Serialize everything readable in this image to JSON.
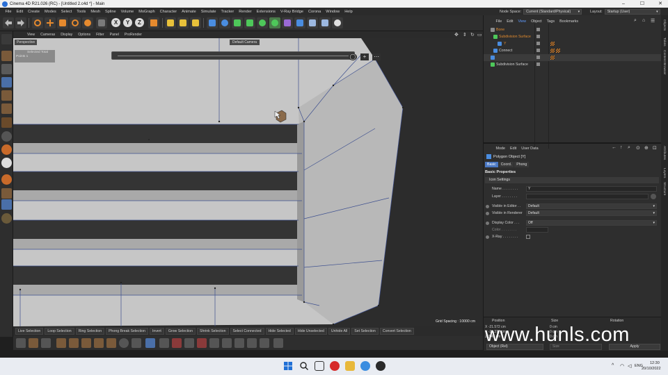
{
  "window": {
    "title": "Cinema 4D R21.026 (RC) - [Untitled 2.c4d *] - Main",
    "controls": [
      "–",
      "☐",
      "✕"
    ]
  },
  "menubar": {
    "items": [
      "File",
      "Edit",
      "Create",
      "Modes",
      "Select",
      "Tools",
      "Mesh",
      "Spline",
      "Volume",
      "MoGraph",
      "Character",
      "Animate",
      "Simulate",
      "Tracker",
      "Render",
      "Extensions",
      "V-Ray Bridge",
      "Corona",
      "Window",
      "Help"
    ],
    "node_space_label": "Node Space:",
    "node_space_value": "Current (Standard/Physical)",
    "layout_label": "Layout:",
    "layout_value": "Startup (User)"
  },
  "toolbar": {
    "axis_labels": [
      "X",
      "Y",
      "Z"
    ]
  },
  "viewport_menu": {
    "items": [
      "View",
      "Cameras",
      "Display",
      "Options",
      "Filter",
      "Panel",
      "ProRender"
    ]
  },
  "viewport": {
    "view_name": "Perspective",
    "camera": "Default Camera",
    "hud_line1": "Selected Total",
    "hud_line2": "Points  1",
    "zoom_plus": "+",
    "grid_spacing": "Grid Spacing : 10000 cm"
  },
  "selection_tools": [
    "Live Selection",
    "Loop Selection",
    "Ring Selection",
    "Phong Break Selection",
    "Invert",
    "Grow Selection",
    "Shrink Selection",
    "Select Connected",
    "Hide Selected",
    "Hide Unselected",
    "Unhide All",
    "Set Selection",
    "Convert Selection"
  ],
  "object_manager": {
    "menu": [
      "File",
      "Edit",
      "View",
      "Object",
      "Tags",
      "Bookmarks"
    ],
    "active_menu": "View",
    "objects": [
      {
        "name": "Bone",
        "indent": 0,
        "color": "#e08a2e"
      },
      {
        "name": "Subdivision Surface",
        "indent": 1,
        "color": "#e08a2e"
      },
      {
        "name": "Y",
        "indent": 2,
        "color": "#e08a2e"
      },
      {
        "name": "Connect",
        "indent": 1,
        "color": "#d0d0d0"
      },
      {
        "name": "",
        "indent": 0,
        "color": "#d0d0d0"
      },
      {
        "name": "Subdivision Surface",
        "indent": 0,
        "color": "#d0d0d0"
      }
    ]
  },
  "attributes": {
    "menu": [
      "Mode",
      "Edit",
      "User Data"
    ],
    "object_title": "Polygon Object [Y]",
    "tabs": [
      "Basic",
      "Coord.",
      "Phong"
    ],
    "active_tab": "Basic",
    "section": "Basic Properties",
    "group": "Icon Settings",
    "props": [
      {
        "label": "Name . . . . . . . .",
        "value": "Y",
        "type": "text"
      },
      {
        "label": "Layer . . . . . . . .",
        "value": "",
        "type": "text"
      },
      {
        "label": "Visible in Editor . .",
        "value": "Default",
        "type": "dropdown"
      },
      {
        "label": "Visible in Renderer",
        "value": "Default",
        "type": "dropdown"
      },
      {
        "label": "Display Color . . .",
        "value": "Off",
        "type": "dropdown"
      },
      {
        "label": "Color . . . . . . . .",
        "value": "",
        "type": "swatch"
      },
      {
        "label": "X-Ray . . . . . . . .",
        "value": "",
        "type": "checkbox"
      }
    ]
  },
  "coordinates": {
    "headers": [
      "Position",
      "Size",
      "Rotation"
    ],
    "rows": [
      {
        "axis": "X",
        "pos": "-21.572 cm",
        "size": "0 cm"
      },
      {
        "axis": "Y",
        "pos": "-21.377 cm",
        "size": "0 cm"
      },
      {
        "axis": "Z",
        "pos": "3.45 cm",
        "size": "0 cm"
      }
    ],
    "mode": "Object (Rel)",
    "size_mode": "Size",
    "apply": "Apply"
  },
  "side_tabs": [
    "Objects",
    "Takes",
    "Content Browser",
    "Attributes",
    "Layers",
    "Structure"
  ],
  "watermark": "www.hunls.com",
  "taskbar": {
    "time": "12:30",
    "date": "20/10/2022",
    "lang": "ENG"
  },
  "colors": {
    "accent_blue": "#4a78c4",
    "orange": "#e08a2e",
    "mesh_gray": "#c8c8c8",
    "slot_dark": "#333333"
  }
}
